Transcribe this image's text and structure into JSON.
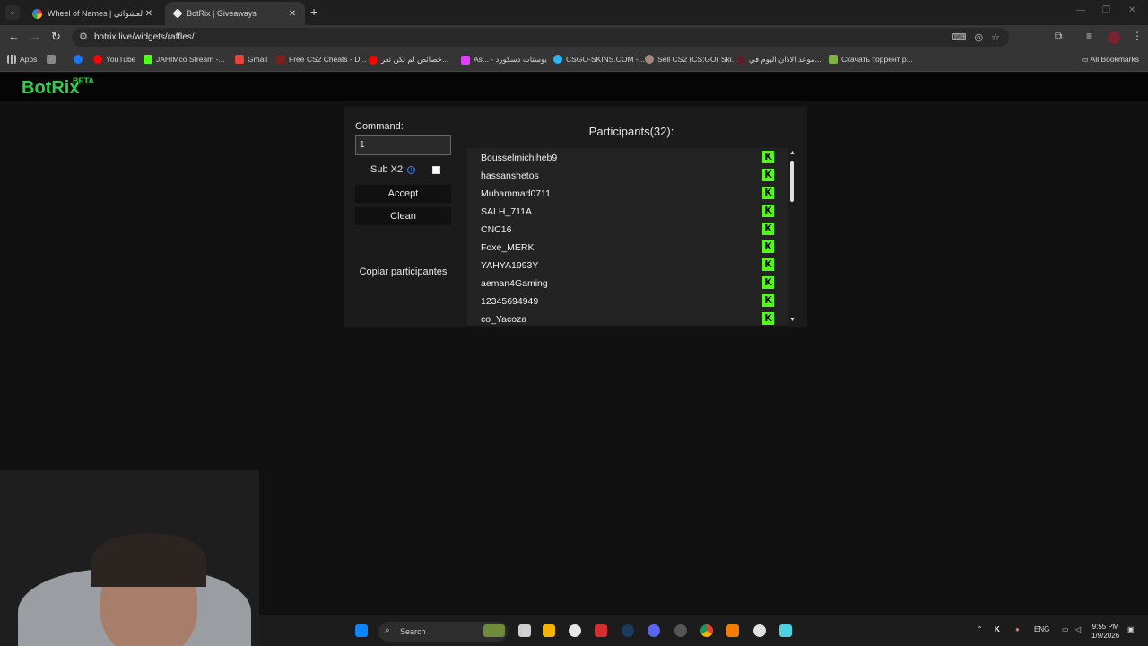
{
  "browser": {
    "tabs": [
      {
        "title": "Wheel of Names | اسم العشوائي"
      },
      {
        "title": "BotRix | Giveaways"
      }
    ],
    "url": "botrix.live/widgets/raffles/",
    "bookmarks": [
      {
        "label": "Apps"
      },
      {
        "label": "YouTube"
      },
      {
        "label": "JAHIMco Stream -..."
      },
      {
        "label": "Gmail"
      },
      {
        "label": "Free CS2 Cheats - D..."
      },
      {
        "label": "خصائص لم تكن تعر..."
      },
      {
        "label": "As... - بوستات دسكورد"
      },
      {
        "label": "CSGO-SKINS.COM -..."
      },
      {
        "label": "Sell CS2 (CS:GO) Ski..."
      },
      {
        "label": "موعد الاذان اليوم في..."
      },
      {
        "label": "Скачать торрент р..."
      }
    ],
    "all_bookmarks": "All Bookmarks"
  },
  "site": {
    "logo": "BotRix",
    "logo_badge": "BETA"
  },
  "raffle": {
    "command_label": "Command:",
    "command_value": "1",
    "sub_label": "Sub X2",
    "accept_label": "Accept",
    "clean_label": "Clean",
    "copy_label": "Copiar participantes",
    "participants_title": "Participants(32):",
    "participants": [
      "Bousselmichiheb9",
      "hassanshetos",
      "Muhammad0711",
      "SALH_711A",
      "CNC16",
      "Foxe_MERK",
      "YAHYA1993Y",
      "aeman4Gaming",
      "12345694949",
      "co_Yacoza"
    ],
    "platform_badge": "K",
    "platform_color": "#53fc18"
  },
  "taskbar": {
    "search_label": "Search",
    "lang": "ENG",
    "time": "9:55 PM",
    "date": "1/9/2026"
  }
}
